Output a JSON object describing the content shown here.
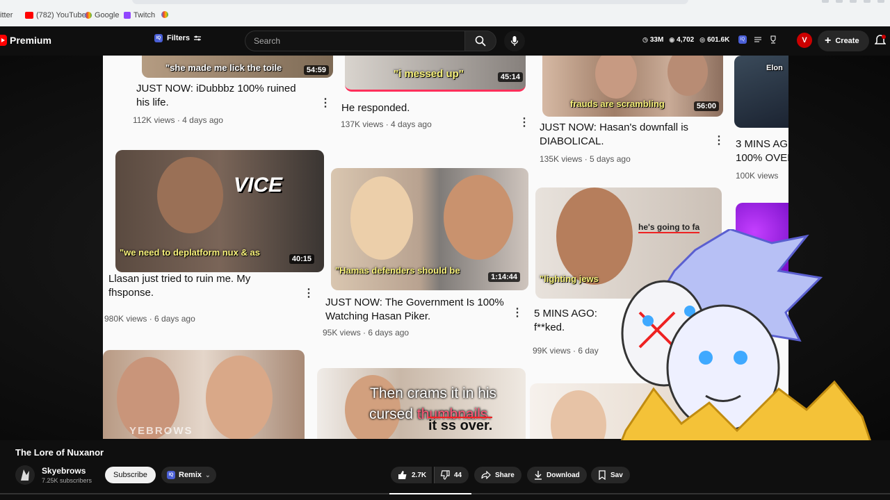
{
  "browser": {
    "bookmarks": [
      {
        "label": "Twitter"
      },
      {
        "label": "(782) YouTube"
      },
      {
        "label": "Google"
      },
      {
        "label": "Twitch"
      },
      {
        "label": ""
      }
    ]
  },
  "header": {
    "brand": "Premium",
    "filters_label": "Filters",
    "search_placeholder": "Search",
    "stats": {
      "a": "33M",
      "b": "4,702",
      "c": "601.6K"
    },
    "v_label": "V",
    "create_label": "Create"
  },
  "captured_page": {
    "top_row": [
      {
        "caption": "\"she made me lick the toile",
        "duration": "54:59",
        "title": "JUST NOW: iDubbbz 100% ruined his life.",
        "views": "112K views",
        "age": "4 days ago"
      },
      {
        "caption": "\"i messed up\"",
        "duration": "45:14",
        "title": "He responded.",
        "views": "137K views",
        "age": "4 days ago"
      },
      {
        "caption": "frauds are scrambling",
        "duration": "56:00",
        "title": "JUST NOW: Hasan's downfall is DIABOLICAL.",
        "views": "135K views",
        "age": "5 days ago"
      },
      {
        "caption": "Elon",
        "title": "3 MINS AG",
        "title2": "100% OVER",
        "views": "100K views"
      }
    ],
    "mid_row": [
      {
        "logo": "VICE",
        "caption": "\"we need to deplatform nux & as",
        "duration": "40:15",
        "title": "Llasan just tried to ruin me. My fhsponse.",
        "views": "980K views",
        "age": "6 days ago"
      },
      {
        "caption": "\"Hamas defenders should be",
        "duration": "1:14:44",
        "title": "JUST NOW: The Government Is 100% Watching Hasan Piker.",
        "views": "95K views",
        "age": "6 days ago"
      },
      {
        "caption": "\"lighting jews",
        "overlay": "he's going to fa",
        "title": "5 MINS AGO:",
        "title2": "f**ked.",
        "views": "99K views",
        "age": "6 day"
      }
    ],
    "bottom_row_watermark": "YEBROWS"
  },
  "subtitles": {
    "line1": "Then crams it in his",
    "line2a": "cursed",
    "line2b": "thumbnails.",
    "overlay": "it ss over."
  },
  "video_info": {
    "title": "The Lore of Nuxanor",
    "channel": "Skyebrows",
    "subscribers": "7.25K subscribers",
    "subscribe_label": "Subscribe",
    "remix_label": "Remix",
    "likes": "2.7K",
    "dislikes": "44",
    "share_label": "Share",
    "download_label": "Download",
    "save_label": "Sav"
  },
  "colors": {
    "accent": "#ff0000",
    "background": "#0f0f0f",
    "caption_yellow": "#f7f17a",
    "subtitle_pink": "#ff5a7a"
  }
}
